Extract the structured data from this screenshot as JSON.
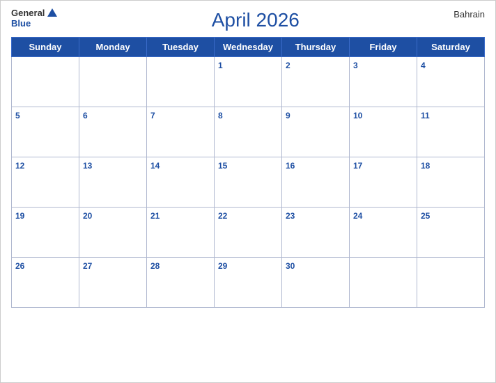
{
  "header": {
    "logo_general": "General",
    "logo_blue": "Blue",
    "month_title": "April 2026",
    "country": "Bahrain"
  },
  "weekdays": [
    "Sunday",
    "Monday",
    "Tuesday",
    "Wednesday",
    "Thursday",
    "Friday",
    "Saturday"
  ],
  "weeks": [
    [
      null,
      null,
      null,
      1,
      2,
      3,
      4
    ],
    [
      5,
      6,
      7,
      8,
      9,
      10,
      11
    ],
    [
      12,
      13,
      14,
      15,
      16,
      17,
      18
    ],
    [
      19,
      20,
      21,
      22,
      23,
      24,
      25
    ],
    [
      26,
      27,
      28,
      29,
      30,
      null,
      null
    ]
  ]
}
